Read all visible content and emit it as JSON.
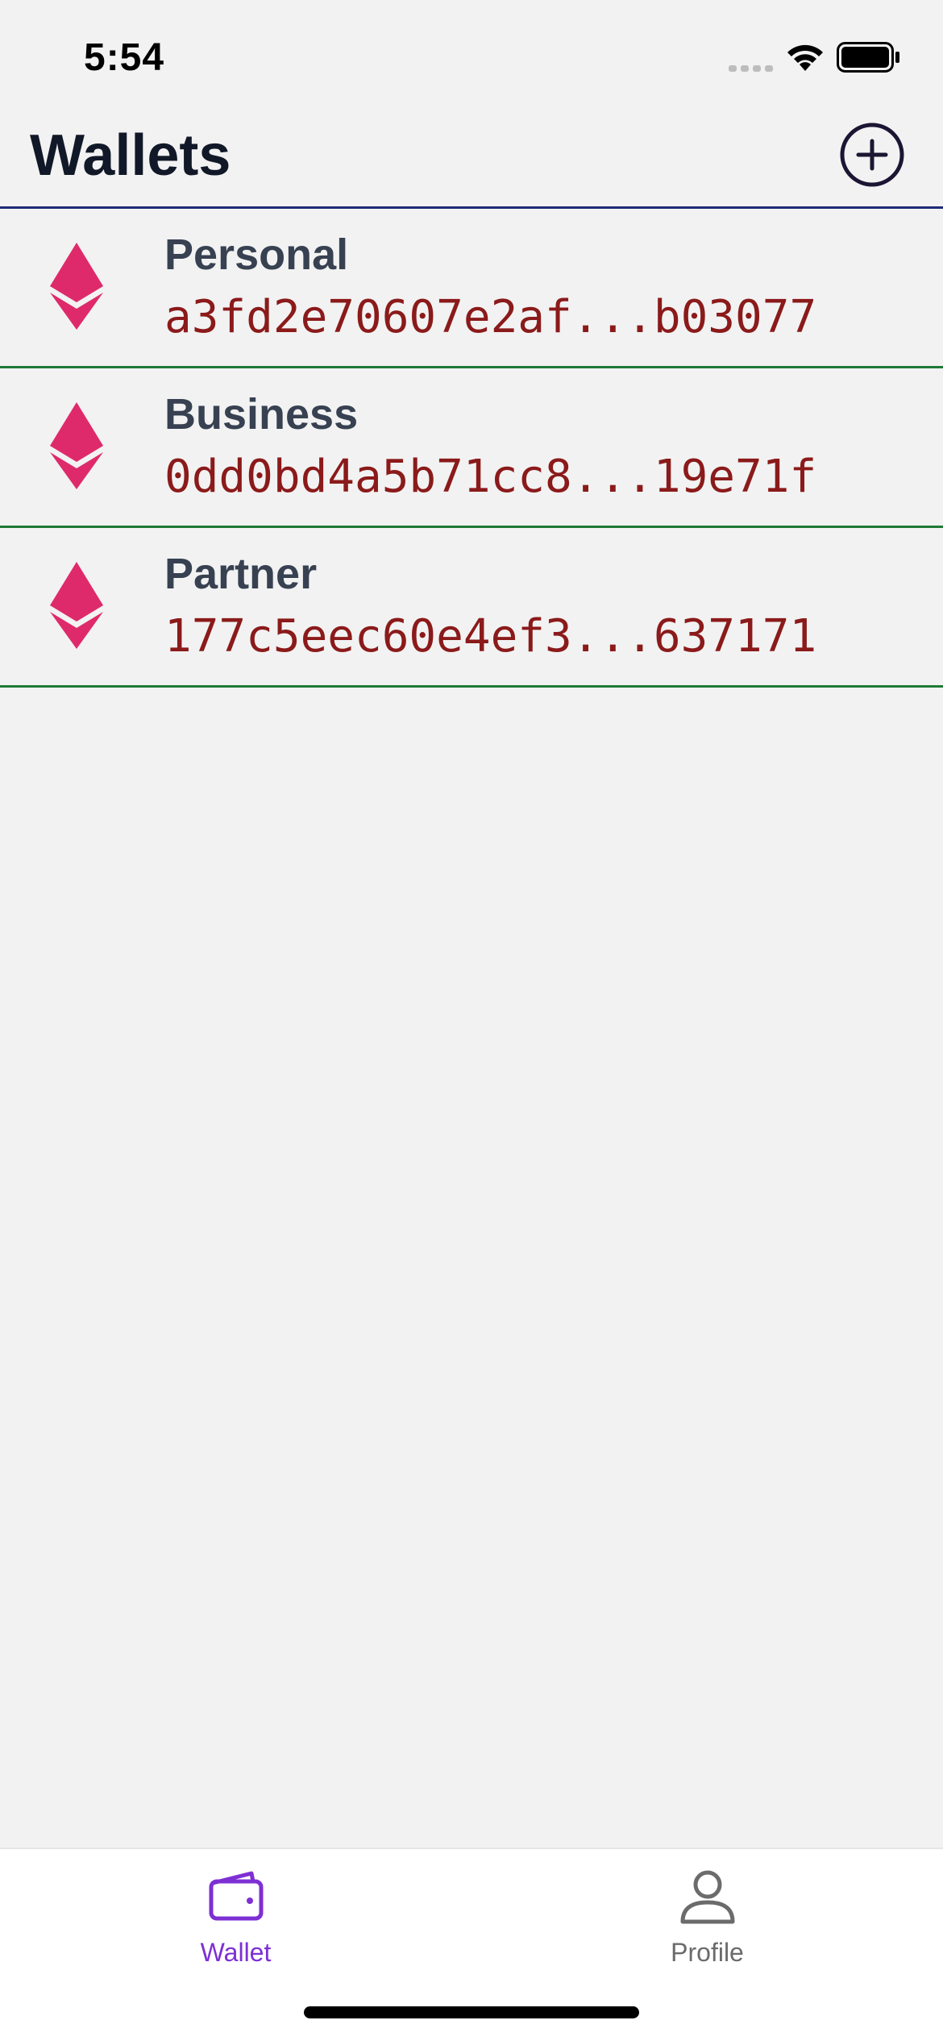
{
  "status_bar": {
    "time": "5:54"
  },
  "header": {
    "title": "Wallets",
    "add_icon": "plus-circle-icon"
  },
  "wallets": [
    {
      "name": "Personal",
      "address": "a3fd2e70607e2af...b03077"
    },
    {
      "name": "Business",
      "address": "0dd0bd4a5b71cc8...19e71f"
    },
    {
      "name": "Partner",
      "address": "177c5eec60e4ef3...637171"
    }
  ],
  "tabs": [
    {
      "label": "Wallet",
      "icon": "wallet-icon",
      "active": true
    },
    {
      "label": "Profile",
      "icon": "person-icon",
      "active": false
    }
  ],
  "colors": {
    "accent": "#7e2fd4",
    "eth_icon": "#de2a6b",
    "address_text": "#8b1a1a",
    "header_border": "#1e2a78",
    "row_border": "#1f7a35"
  }
}
